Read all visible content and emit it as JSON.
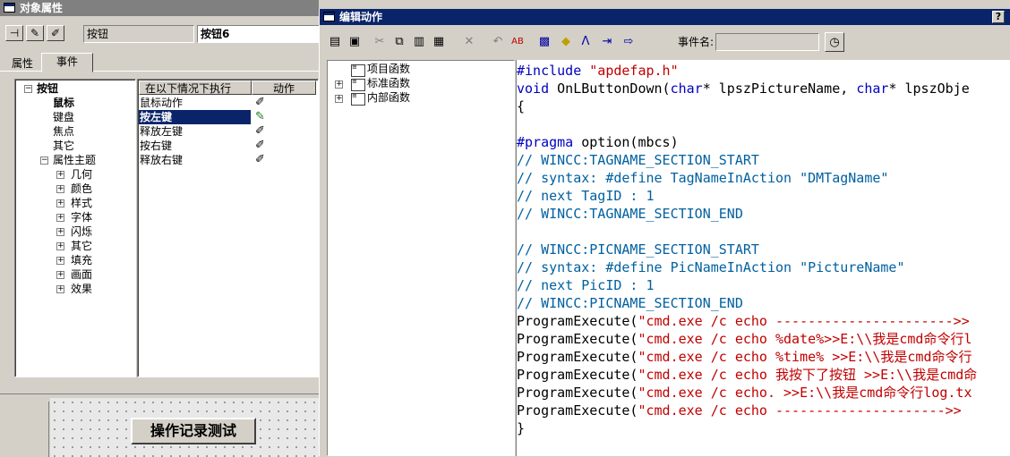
{
  "props_window": {
    "title": "对象属性",
    "object_type": "按钮",
    "object_name": "按钮6",
    "tabs": [
      {
        "label": "属性"
      },
      {
        "label": "事件"
      }
    ],
    "tree": {
      "root": "按钮",
      "children": [
        "鼠标",
        "键盘",
        "焦点",
        "其它"
      ],
      "theme": "属性主题",
      "theme_children": [
        "几何",
        "颜色",
        "样式",
        "字体",
        "闪烁",
        "其它",
        "填充",
        "画面",
        "效果"
      ]
    },
    "events_table": {
      "col1": "在以下情况下执行",
      "col2": "动作",
      "rows": [
        "鼠标动作",
        "按左键",
        "释放左键",
        "按右键",
        "释放右键"
      ]
    }
  },
  "canvas": {
    "button_label": "操作记录测试"
  },
  "editor_window": {
    "title": "编辑动作",
    "event_name_label": "事件名:",
    "event_name_value": "",
    "func_tree": [
      "项目函数",
      "标准函数",
      "内部函数"
    ],
    "code": {
      "l1_a": "#include ",
      "l1_b": "\"apdefap.h\"",
      "l2_a": "void",
      "l2_b": " OnLButtonDown(",
      "l2_c": "char",
      "l2_d": "* lpszPictureName, ",
      "l2_e": "char",
      "l2_f": "* lpszObje",
      "l3": "{",
      "l5_a": "#pragma",
      "l5_b": " option(mbcs)",
      "l6": "// WINCC:TAGNAME_SECTION_START",
      "l7": "// syntax: #define TagNameInAction \"DMTagName\"",
      "l8": "// next TagID : 1",
      "l9": "// WINCC:TAGNAME_SECTION_END",
      "l11": "// WINCC:PICNAME_SECTION_START",
      "l12": "// syntax: #define PicNameInAction \"PictureName\"",
      "l13": "// next PicID : 1",
      "l14": "// WINCC:PICNAME_SECTION_END",
      "pe": "ProgramExecute(",
      "s15": "\"cmd.exe /c echo ---------------------->>",
      "s16": "\"cmd.exe /c echo %date%>>E:\\\\我是cmd命令行l",
      "s17": "\"cmd.exe /c echo %time% >>E:\\\\我是cmd命令行",
      "s18": "\"cmd.exe /c echo 我按下了按钮 >>E:\\\\我是cmd命",
      "s19": "\"cmd.exe /c echo. >>E:\\\\我是cmd命令行log.tx",
      "s20": "\"cmd.exe /c echo --------------------->>",
      "l21": "}"
    }
  }
}
